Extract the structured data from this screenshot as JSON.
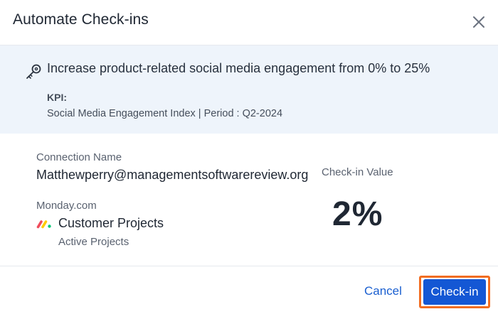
{
  "dialog": {
    "title": "Automate Check-ins",
    "close_icon": "close-icon"
  },
  "objective": {
    "icon": "key-icon",
    "text": "Increase product-related social media engagement from 0% to 25%",
    "kpi_label": "KPI:",
    "kpi_detail": "Social Media Engagement Index | Period : Q2-2024"
  },
  "connection": {
    "label": "Connection Name",
    "value": "Matthewperry@managementsoftwarereview.org"
  },
  "source": {
    "label": "Monday.com",
    "icon": "monday-logo-icon",
    "board": "Customer Projects",
    "group": "Active Projects"
  },
  "checkin": {
    "label": "Check-in Value",
    "value": "2%"
  },
  "footer": {
    "cancel_label": "Cancel",
    "checkin_label": "Check-in"
  },
  "colors": {
    "accent": "#1457d4",
    "link": "#1a5fd0",
    "highlight": "#f26d21",
    "panel_bg": "#eef4fb",
    "monday_red": "#f04c5b",
    "monday_yellow": "#ffcb00",
    "monday_green": "#00c875"
  }
}
